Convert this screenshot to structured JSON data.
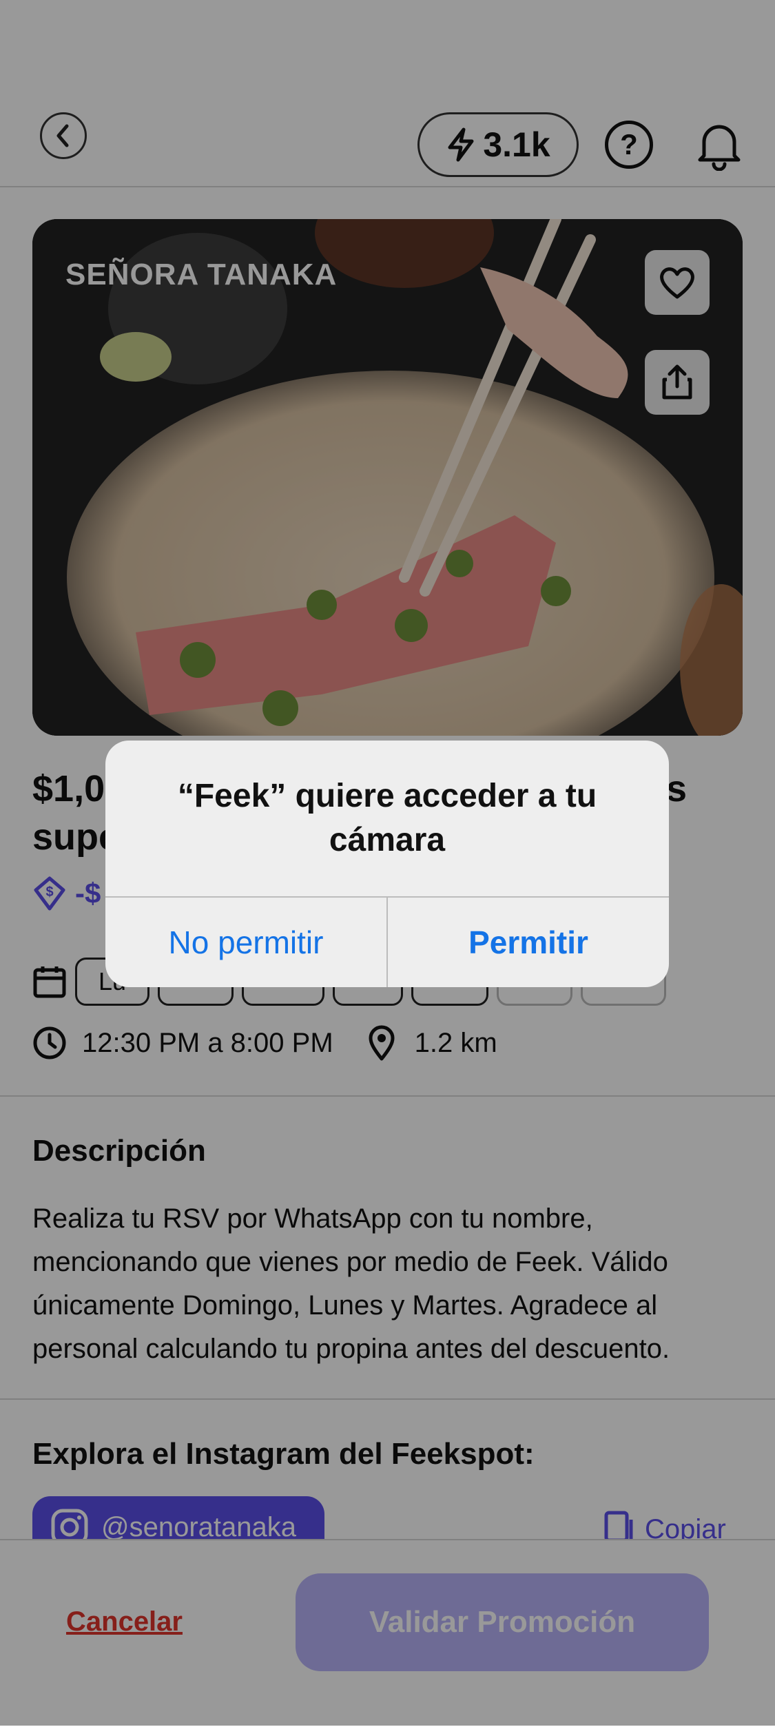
{
  "header": {
    "points": "3.1k",
    "help_symbol": "?",
    "icons": [
      "back-arrow",
      "lightning",
      "help",
      "bell"
    ]
  },
  "hero": {
    "brand": "SEÑORA TANAKA",
    "icons": [
      "heart",
      "share"
    ]
  },
  "offer": {
    "title_line1": "$1,0",
    "title_line1_end": "s",
    "title_line2": "supe",
    "discount": "-$",
    "days": [
      "Lu",
      "",
      "",
      "",
      "",
      "",
      ""
    ],
    "hours": "12:30 PM a 8:00 PM",
    "distance": "1.2 km"
  },
  "description": {
    "title": "Descripción",
    "text": "Realiza tu RSV por WhatsApp con tu nombre, mencionando que vienes por medio de Feek. Válido únicamente Domingo, Lunes y Martes. Agradece al personal calculando tu propina antes del descuento."
  },
  "instagram": {
    "title": "Explora el Instagram del Feekspot:",
    "handle": "@senoratanaka",
    "copy_label": "Copiar"
  },
  "bottom": {
    "cancel_label": "Cancelar",
    "validate_label": "Validar Promoción"
  },
  "alert": {
    "message": "“Feek” quiere acceder a tu cámara",
    "deny_label": "No permitir",
    "allow_label": "Permitir"
  },
  "colors": {
    "accent": "#5b4fe8",
    "danger": "#e0352c",
    "ios_blue": "#1473e6"
  }
}
